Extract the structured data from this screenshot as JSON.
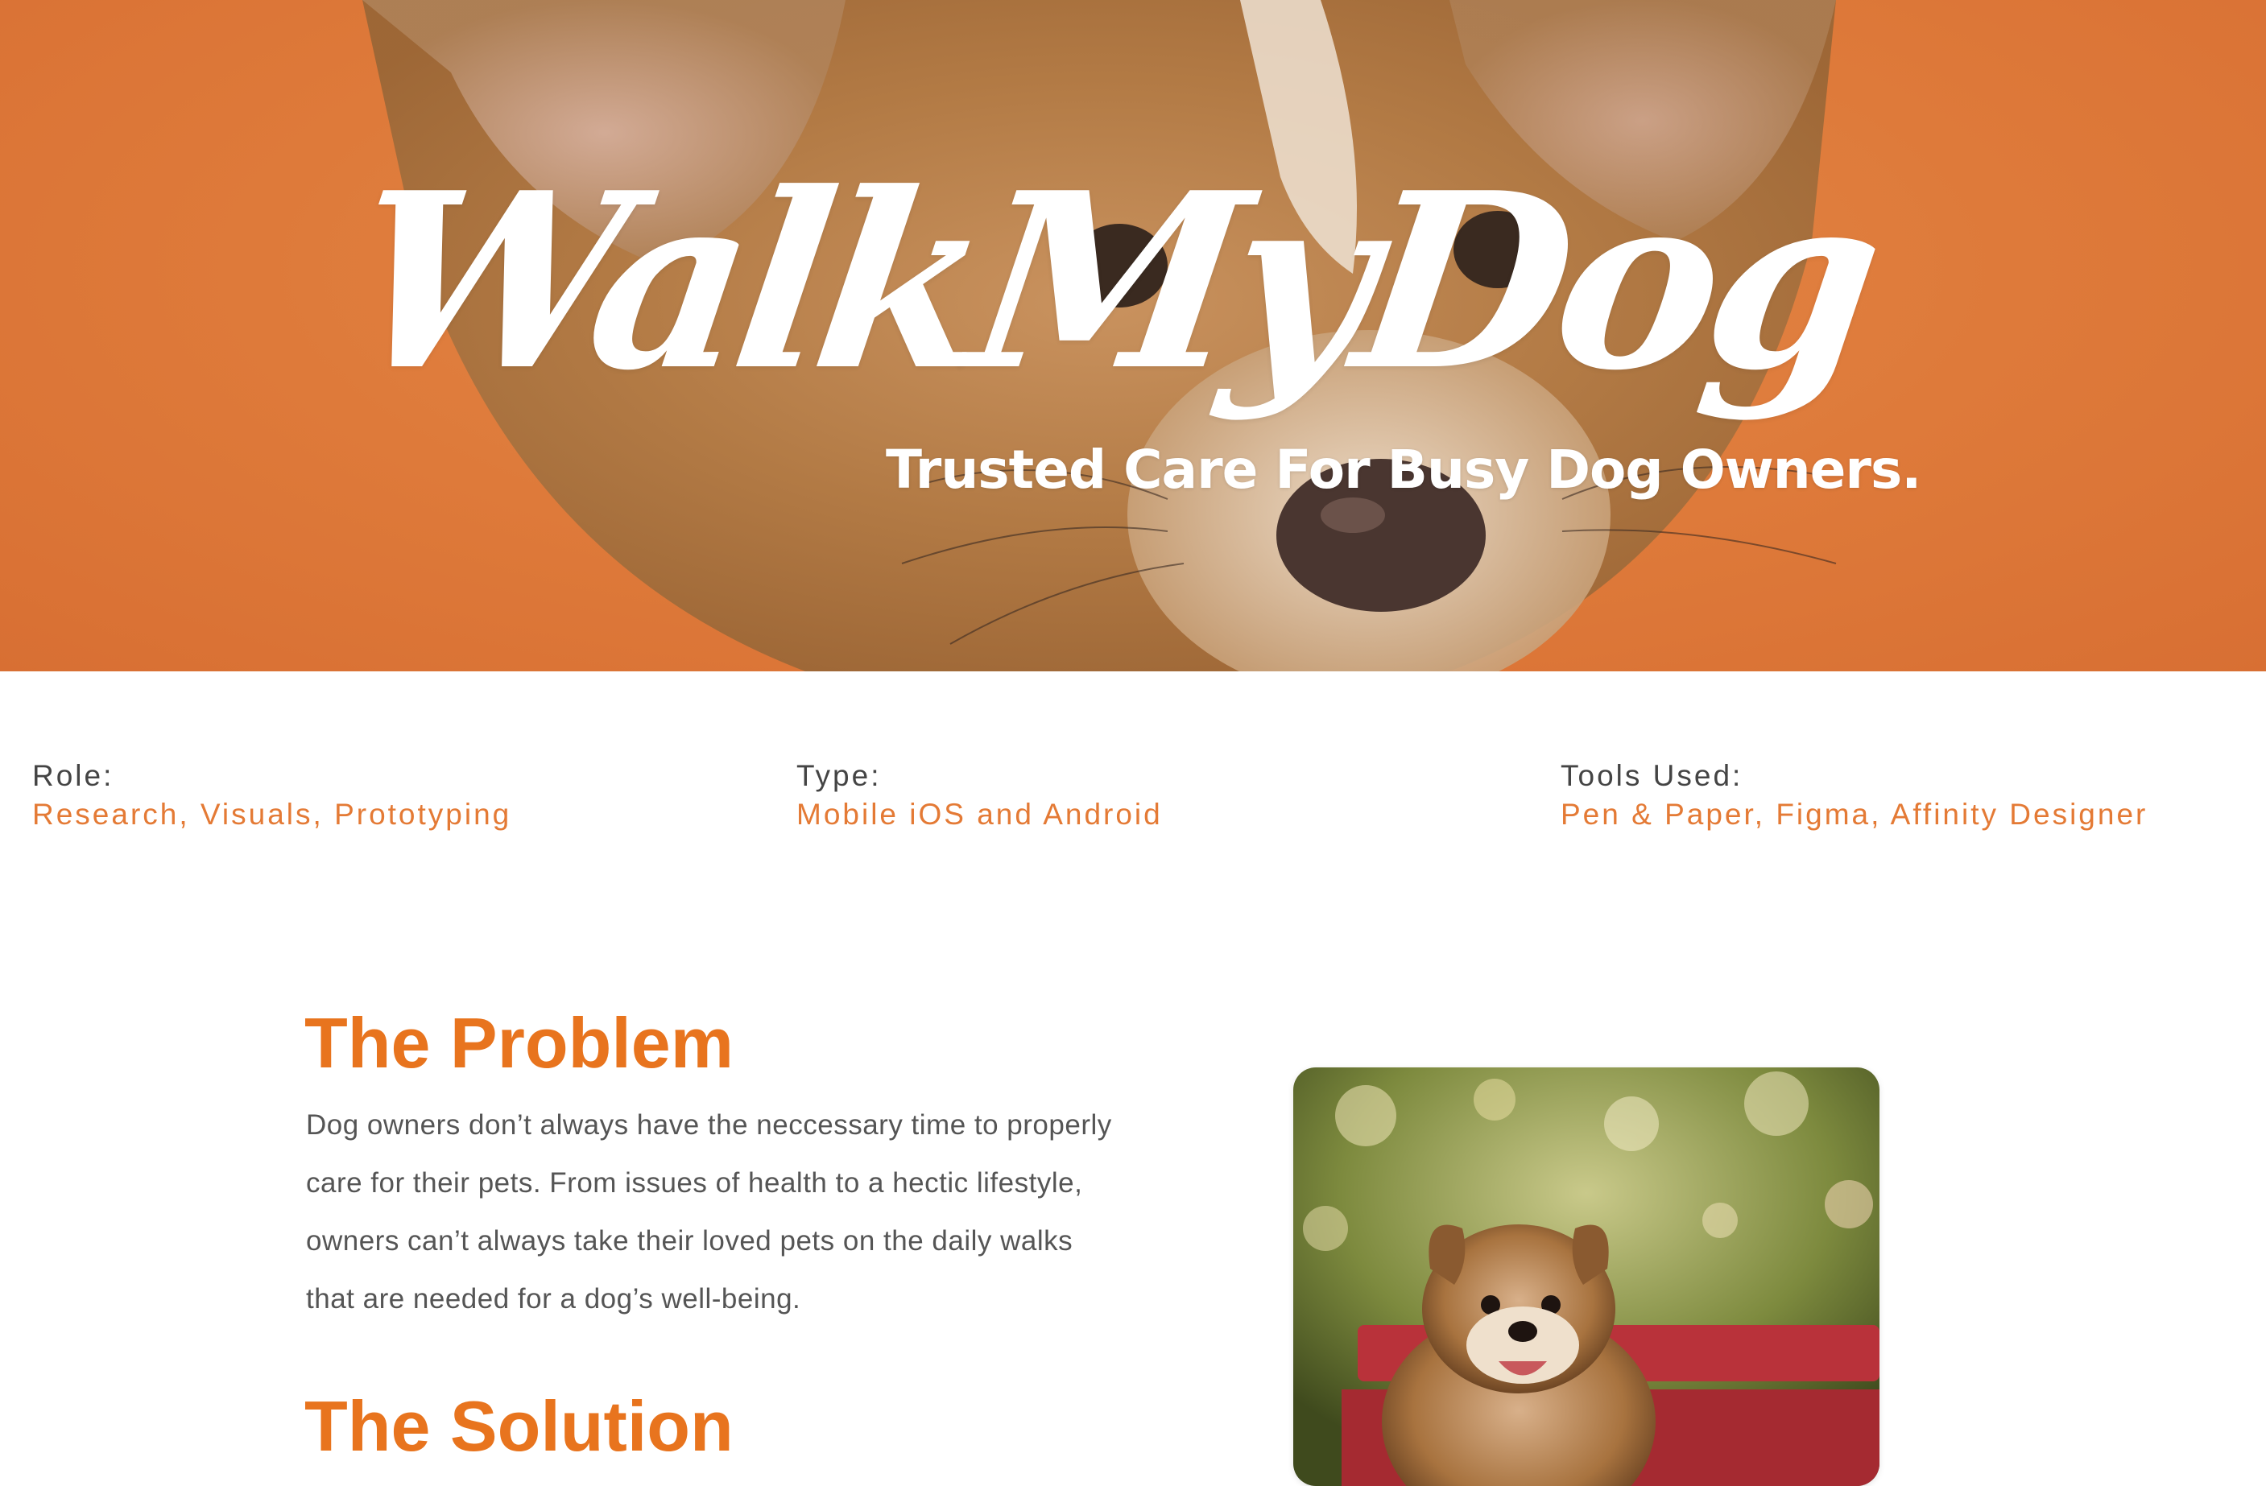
{
  "hero": {
    "title": "WalkMyDog",
    "tagline": "Trusted Care For Busy Dog Owners.",
    "background_color": "#e07f3f"
  },
  "meta": {
    "role_label": "Role:",
    "role_value": "Research, Visuals, Prototyping",
    "type_label": "Type:",
    "type_value": "Mobile iOS and Android",
    "tools_label": "Tools Used:",
    "tools_value": "Pen & Paper, Figma, Affinity Designer"
  },
  "problem": {
    "heading": "The Problem",
    "body": "Dog owners don’t always have the neccessary time to properly care for their pets. From issues of health to a hectic lifestyle, owners can’t always take their loved pets on the daily walks that are needed for a dog’s well-being."
  },
  "solution": {
    "heading": "The Solution"
  },
  "colors": {
    "accent": "#e8741e",
    "label_text": "#444444",
    "body_text": "#555555"
  }
}
